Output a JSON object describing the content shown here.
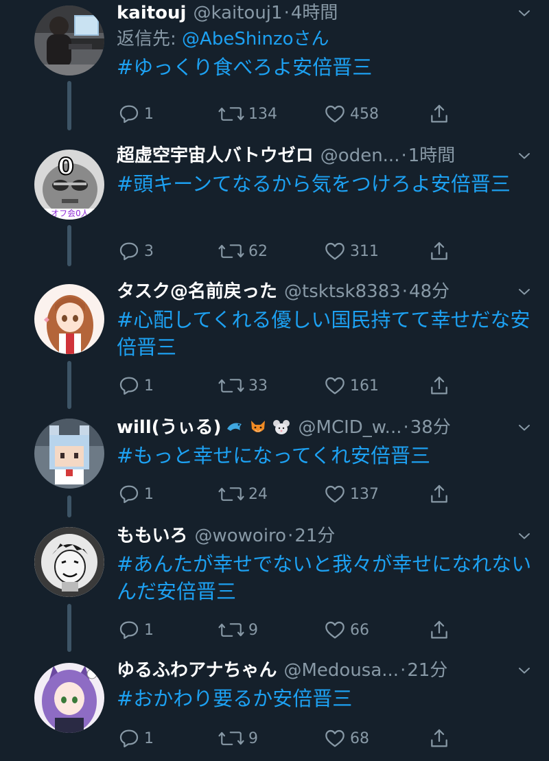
{
  "tweets": [
    {
      "name": "kaitouj",
      "handle": "@kaitouj1",
      "time": "4時間",
      "reply_label": "返信先: ",
      "reply_mention": "@AbeShinzoさん",
      "text": "#ゆっくり食べろよ安倍晋三",
      "replies": "1",
      "retweets": "134",
      "likes": "458"
    },
    {
      "name": "超虚空宇宙人バトウゼロ",
      "handle": "@oden...",
      "time": "1時間",
      "text": "#頭キーンてなるから気をつけろよ安倍晋三",
      "replies": "3",
      "retweets": "62",
      "likes": "311"
    },
    {
      "name": "タスク@名前戻った",
      "handle": "@tsktsk8383",
      "time": "48分",
      "text": "#心配してくれる優しい国民持てて幸せだな安倍晋三",
      "replies": "1",
      "retweets": "33",
      "likes": "161"
    },
    {
      "name": "will(うぃる)",
      "name_emojis": [
        "dolphin-emoji",
        "fox-emoji",
        "mouse-emoji"
      ],
      "handle": "@MCID_w...",
      "time": "38分",
      "text": "#もっと幸せになってくれ安倍晋三",
      "replies": "1",
      "retweets": "24",
      "likes": "137"
    },
    {
      "name": "ももいろ",
      "handle": "@wowoiro",
      "time": "21分",
      "text": "#あんたが幸せでないと我々が幸せになれないんだ安倍晋三",
      "replies": "1",
      "retweets": "9",
      "likes": "66"
    },
    {
      "name": "ゆるふわアナちゃん",
      "handle": "@Medousa...",
      "time": "21分",
      "text": "#おかわり要るか安倍晋三",
      "replies": "1",
      "retweets": "9",
      "likes": "68"
    }
  ],
  "avatar_text": {
    "zero": "0",
    "caption": "オフ会0人"
  },
  "colors": {
    "background": "#15202b",
    "link": "#1da1f2",
    "secondary": "#8899a6",
    "thread_line": "#3d5466"
  },
  "icons": {
    "reply": "reply-icon",
    "retweet": "retweet-icon",
    "like": "heart-icon",
    "share": "share-icon",
    "menu": "chevron-down-icon"
  }
}
